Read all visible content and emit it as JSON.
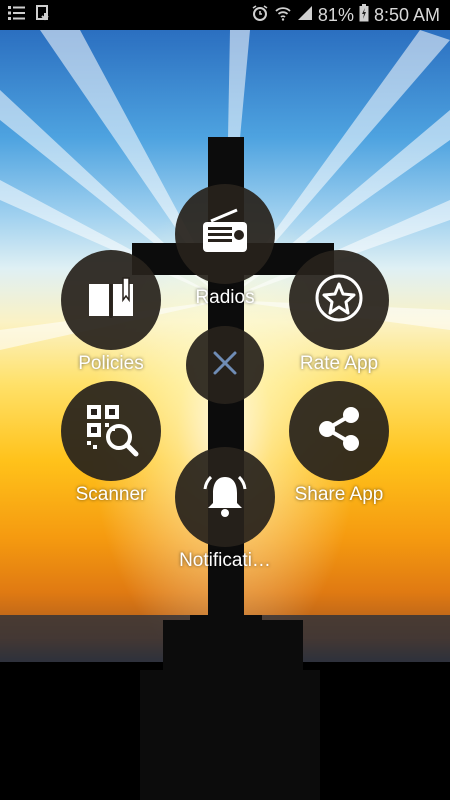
{
  "status_bar": {
    "battery_percent": "81%",
    "time": "8:50 AM",
    "icons": [
      "menu-list-icon",
      "download-icon",
      "alarm-icon",
      "wifi-icon",
      "signal-icon",
      "battery-charging-icon"
    ]
  },
  "menu": {
    "items": [
      {
        "label": "Radios",
        "icon": "radio-icon"
      },
      {
        "label": "Policies",
        "icon": "book-icon"
      },
      {
        "label": "Rate App",
        "icon": "star-icon"
      },
      {
        "label": "Scanner",
        "icon": "qr-scan-icon"
      },
      {
        "label": "Share App",
        "icon": "share-icon"
      },
      {
        "label": "Notificati…",
        "icon": "bell-icon"
      }
    ],
    "close_icon": "close-icon"
  },
  "colors": {
    "button_bg": "#28221c",
    "close_x": "#6f8cb5",
    "label": "#ffffff"
  }
}
